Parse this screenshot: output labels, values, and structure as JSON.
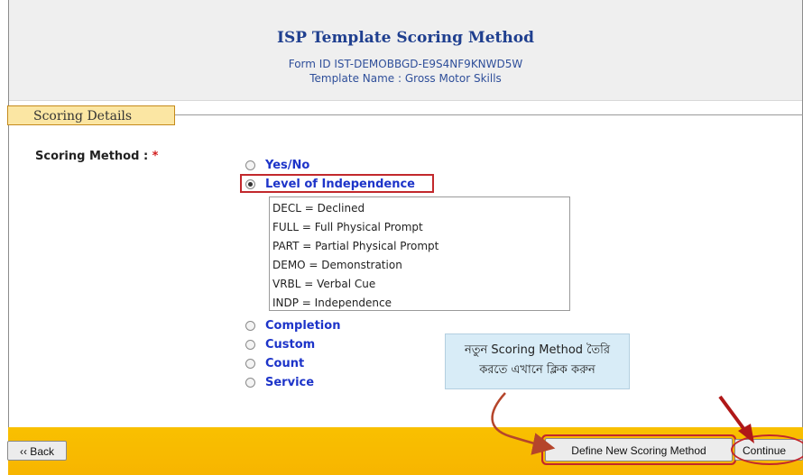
{
  "header": {
    "title": "ISP Template Scoring Method",
    "form_id": "Form ID   IST-DEMOBBGD-E9S4NF9KNWD5W",
    "template_name": "Template Name  :  Gross Motor Skills"
  },
  "section": {
    "legend": "Scoring Details"
  },
  "scoring": {
    "label": "Scoring Method :",
    "required_mark": "*",
    "options": [
      {
        "label": "Yes/No",
        "selected": false
      },
      {
        "label": "Level of Independence",
        "selected": true
      },
      {
        "label": "Completion",
        "selected": false
      },
      {
        "label": "Custom",
        "selected": false
      },
      {
        "label": "Count",
        "selected": false
      },
      {
        "label": "Service",
        "selected": false
      }
    ],
    "levels": [
      "DECL = Declined",
      "FULL = Full Physical Prompt",
      "PART = Partial Physical Prompt",
      "DEMO = Demonstration",
      "VRBL = Verbal Cue",
      "INDP = Independence"
    ]
  },
  "annotation": {
    "line1": "নতুন Scoring Method তৈরি",
    "line2": "করতে এখানে ক্লিক  করুন",
    "highlight_color": "#c2282c",
    "arrow_color": "#b5452b"
  },
  "footer": {
    "back_label": "‹‹ Back",
    "define_label": "Define New Scoring Method",
    "continue_label": "Continue"
  }
}
